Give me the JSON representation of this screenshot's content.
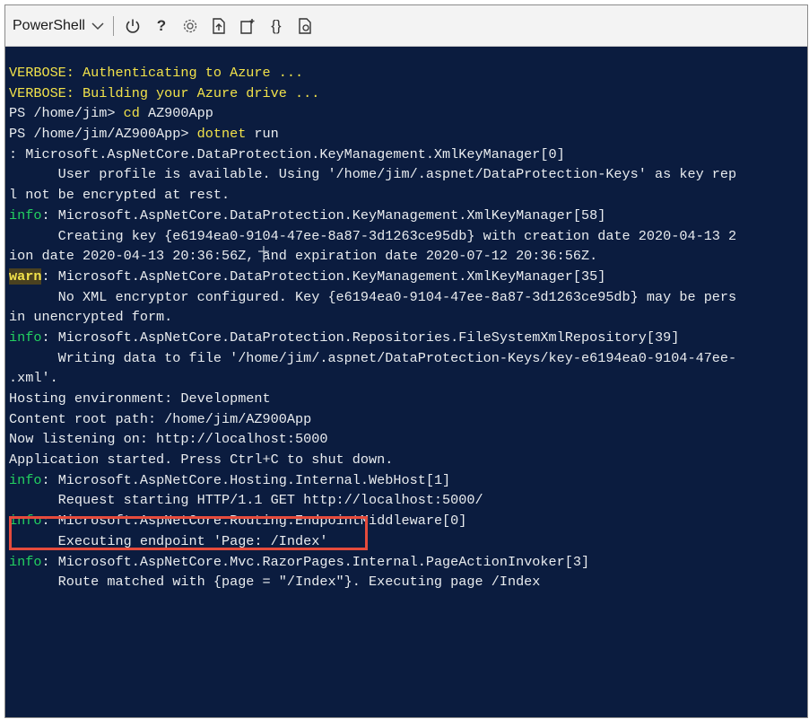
{
  "toolbar": {
    "shell_label": "PowerShell",
    "icons": [
      {
        "name": "power-icon",
        "glyph": "power"
      },
      {
        "name": "help-icon",
        "glyph": "?"
      },
      {
        "name": "settings-icon",
        "glyph": "gear"
      },
      {
        "name": "upload-download-icon",
        "glyph": "upload"
      },
      {
        "name": "new-session-icon",
        "glyph": "new"
      },
      {
        "name": "editor-icon",
        "glyph": "{}"
      },
      {
        "name": "web-preview-icon",
        "glyph": "preview"
      }
    ],
    "help_glyph": "?",
    "editor_glyph": "{}"
  },
  "colors": {
    "background": "#0b1c3f",
    "text": "#e9ecef",
    "verbose": "#f2e24a",
    "info": "#23d160",
    "highlight_border": "#e64b3c"
  },
  "console": {
    "lines": [
      {
        "prefix": "VERBOSE: Authenticating to Azure ...",
        "prefix_class": "yellow",
        "text": ""
      },
      {
        "prefix": "VERBOSE: Building your Azure drive ...",
        "prefix_class": "yellow",
        "text": ""
      },
      {
        "prefix": "PS /home/jim> ",
        "prefix_class": "",
        "text": "cd",
        "text_class": "cmd",
        "suffix": " AZ900App"
      },
      {
        "prefix": "PS /home/jim/AZ900App> ",
        "prefix_class": "",
        "text": "dotnet",
        "text_class": "cmd",
        "suffix": " run"
      },
      {
        "prefix": ": Microsoft.AspNetCore.DataProtection.KeyManagement.XmlKeyManager[0]",
        "prefix_class": "",
        "text": ""
      },
      {
        "prefix": "      User profile is available. Using '/home/jim/.aspnet/DataProtection-Keys' as key rep",
        "prefix_class": "",
        "text": ""
      },
      {
        "prefix": "l not be encrypted at rest.",
        "prefix_class": "",
        "text": ""
      },
      {
        "prefix": "info",
        "prefix_class": "green",
        "text": ": Microsoft.AspNetCore.DataProtection.KeyManagement.XmlKeyManager[58]"
      },
      {
        "prefix": "      Creating key {e6194ea0-9104-47ee-8a87-3d1263ce95db} with creation date 2020-04-13 2",
        "prefix_class": "",
        "text": ""
      },
      {
        "prefix": "ion date 2020-04-13 20:36:56Z, and expiration date 2020-07-12 20:36:56Z.",
        "prefix_class": "",
        "text": ""
      },
      {
        "prefix": "warn",
        "prefix_class": "warn",
        "text": ": Microsoft.AspNetCore.DataProtection.KeyManagement.XmlKeyManager[35]"
      },
      {
        "prefix": "      No XML encryptor configured. Key {e6194ea0-9104-47ee-8a87-3d1263ce95db} may be pers",
        "prefix_class": "",
        "text": ""
      },
      {
        "prefix": "in unencrypted form.",
        "prefix_class": "",
        "text": ""
      },
      {
        "prefix": "info",
        "prefix_class": "green",
        "text": ": Microsoft.AspNetCore.DataProtection.Repositories.FileSystemXmlRepository[39]"
      },
      {
        "prefix": "      Writing data to file '/home/jim/.aspnet/DataProtection-Keys/key-e6194ea0-9104-47ee-",
        "prefix_class": "",
        "text": ""
      },
      {
        "prefix": ".xml'.",
        "prefix_class": "",
        "text": ""
      },
      {
        "prefix": "Hosting environment: Development",
        "prefix_class": "",
        "text": ""
      },
      {
        "prefix": "Content root path: /home/jim/AZ900App",
        "prefix_class": "",
        "text": ""
      },
      {
        "prefix": "Now listening on: http://localhost:5000",
        "prefix_class": "",
        "text": ""
      },
      {
        "prefix": "Application started. Press Ctrl+C to shut down.",
        "prefix_class": "",
        "text": ""
      },
      {
        "prefix": "info",
        "prefix_class": "green",
        "text": ": Microsoft.AspNetCore.Hosting.Internal.WebHost[1]"
      },
      {
        "prefix": "      Request starting HTTP/1.1 GET http://localhost:5000/",
        "prefix_class": "",
        "text": ""
      },
      {
        "prefix": "info",
        "prefix_class": "green",
        "text": ": Microsoft.AspNetCore.Routing.EndpointMiddleware[0]"
      },
      {
        "prefix": "      Executing endpoint 'Page: /Index'",
        "prefix_class": "",
        "text": ""
      },
      {
        "prefix": "info",
        "prefix_class": "green",
        "text": ": Microsoft.AspNetCore.Mvc.RazorPages.Internal.PageActionInvoker[3]"
      },
      {
        "prefix": "      Route matched with {page = \"/Index\"}. Executing page /Index",
        "prefix_class": "",
        "text": ""
      }
    ]
  }
}
